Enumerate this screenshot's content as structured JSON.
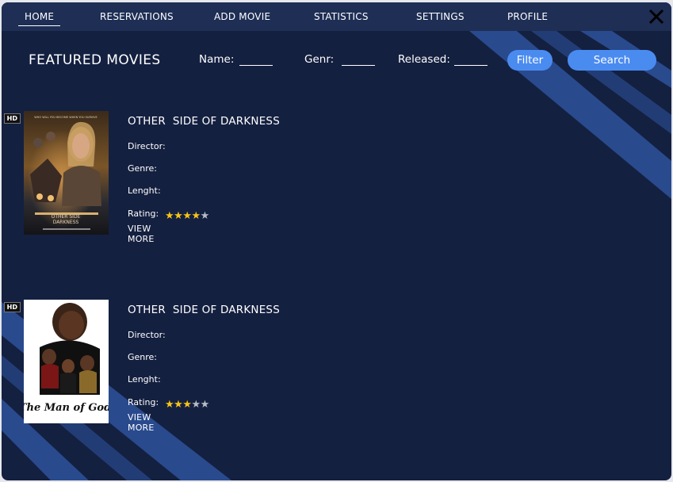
{
  "colors": {
    "background": "#142040",
    "nav_background": "#1e2e55",
    "accent": "#4a8bf0",
    "stripe": "#2a4a8e",
    "star_on": "#f5c518",
    "star_off": "#b8bcc6"
  },
  "nav": {
    "items": [
      {
        "label": "HOME",
        "active": true
      },
      {
        "label": "RESERVATIONS",
        "active": false
      },
      {
        "label": "ADD MOVIE",
        "active": false
      },
      {
        "label": "STATISTICS",
        "active": false
      },
      {
        "label": "SETTINGS",
        "active": false
      },
      {
        "label": "PROFILE",
        "active": false
      }
    ],
    "close_icon": "close-icon"
  },
  "header": {
    "title": "FEATURED MOVIES",
    "filters": {
      "name_label": "Name:",
      "name_value": "",
      "genre_label": "Genr:",
      "genre_value": "",
      "released_label": "Released:",
      "released_value": ""
    },
    "filter_button": "Filter",
    "search_button": "Search"
  },
  "movies": [
    {
      "title": "OTHER  SIDE OF DARKNESS",
      "badge": "HD",
      "director_label": "Director:",
      "genre_label": "Genre:",
      "length_label": "Lenght:",
      "rating_label": "Rating:",
      "rating": 4,
      "rating_max": 5,
      "view_more": "VIEW MORE",
      "poster": {
        "tagline": "WHO WILL YOU BECOME WHEN YOU SURVIVE",
        "title": "OTHER SIDE\nDARKNESS"
      }
    },
    {
      "title": "OTHER  SIDE OF DARKNESS",
      "badge": "HD",
      "director_label": "Director:",
      "genre_label": "Genre:",
      "length_label": "Lenght:",
      "rating_label": "Rating:",
      "rating": 3,
      "rating_max": 5,
      "view_more": "VIEW MORE",
      "poster": {
        "title": "The Man of God"
      }
    }
  ]
}
